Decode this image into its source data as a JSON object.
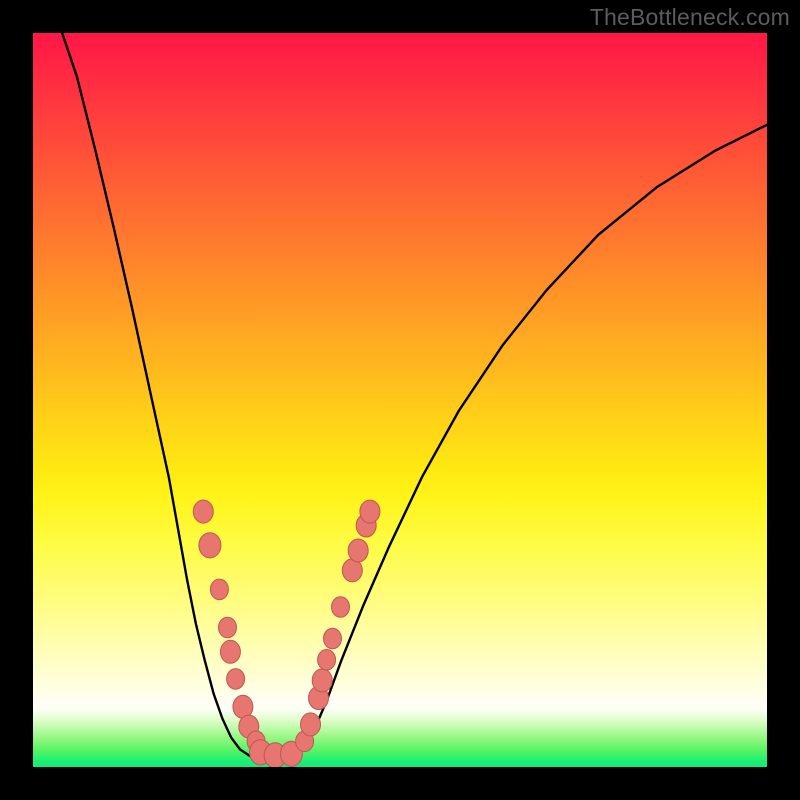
{
  "watermark": "TheBottleneck.com",
  "colors": {
    "curve": "#000000",
    "marker_fill": "#e77570",
    "marker_stroke": "#bd5852"
  },
  "chart_data": {
    "type": "line",
    "title": "",
    "xlabel": "",
    "ylabel": "",
    "xlim": [
      0,
      1
    ],
    "ylim": [
      0,
      1
    ],
    "series": [
      {
        "name": "left-branch",
        "x": [
          0.033,
          0.06,
          0.085,
          0.11,
          0.135,
          0.16,
          0.185,
          0.21,
          0.222,
          0.234,
          0.246,
          0.258,
          0.27,
          0.282,
          0.3
        ],
        "y": [
          1.02,
          0.94,
          0.84,
          0.735,
          0.625,
          0.51,
          0.395,
          0.255,
          0.195,
          0.145,
          0.1,
          0.066,
          0.04,
          0.024,
          0.012
        ]
      },
      {
        "name": "flat-bottom",
        "x": [
          0.3,
          0.32,
          0.34,
          0.36
        ],
        "y": [
          0.012,
          0.012,
          0.012,
          0.014
        ]
      },
      {
        "name": "right-branch",
        "x": [
          0.36,
          0.372,
          0.385,
          0.4,
          0.42,
          0.45,
          0.485,
          0.53,
          0.58,
          0.64,
          0.7,
          0.77,
          0.85,
          0.93,
          1.0
        ],
        "y": [
          0.014,
          0.03,
          0.055,
          0.09,
          0.145,
          0.22,
          0.3,
          0.395,
          0.485,
          0.575,
          0.65,
          0.725,
          0.79,
          0.84,
          0.875
        ]
      }
    ],
    "markers": [
      {
        "x": 0.232,
        "y": 0.348,
        "r": 10
      },
      {
        "x": 0.241,
        "y": 0.302,
        "r": 11
      },
      {
        "x": 0.254,
        "y": 0.242,
        "r": 9
      },
      {
        "x": 0.265,
        "y": 0.19,
        "r": 9
      },
      {
        "x": 0.269,
        "y": 0.157,
        "r": 10
      },
      {
        "x": 0.276,
        "y": 0.12,
        "r": 9
      },
      {
        "x": 0.286,
        "y": 0.082,
        "r": 10
      },
      {
        "x": 0.294,
        "y": 0.055,
        "r": 10
      },
      {
        "x": 0.304,
        "y": 0.035,
        "r": 9
      },
      {
        "x": 0.31,
        "y": 0.02,
        "r": 11
      },
      {
        "x": 0.33,
        "y": 0.016,
        "r": 11
      },
      {
        "x": 0.352,
        "y": 0.018,
        "r": 11
      },
      {
        "x": 0.37,
        "y": 0.035,
        "r": 9
      },
      {
        "x": 0.378,
        "y": 0.058,
        "r": 10
      },
      {
        "x": 0.389,
        "y": 0.094,
        "r": 10
      },
      {
        "x": 0.394,
        "y": 0.118,
        "r": 10
      },
      {
        "x": 0.4,
        "y": 0.146,
        "r": 9
      },
      {
        "x": 0.408,
        "y": 0.175,
        "r": 9
      },
      {
        "x": 0.419,
        "y": 0.218,
        "r": 9
      },
      {
        "x": 0.435,
        "y": 0.268,
        "r": 10
      },
      {
        "x": 0.443,
        "y": 0.295,
        "r": 10
      },
      {
        "x": 0.454,
        "y": 0.329,
        "r": 10
      },
      {
        "x": 0.459,
        "y": 0.348,
        "r": 10
      }
    ]
  }
}
